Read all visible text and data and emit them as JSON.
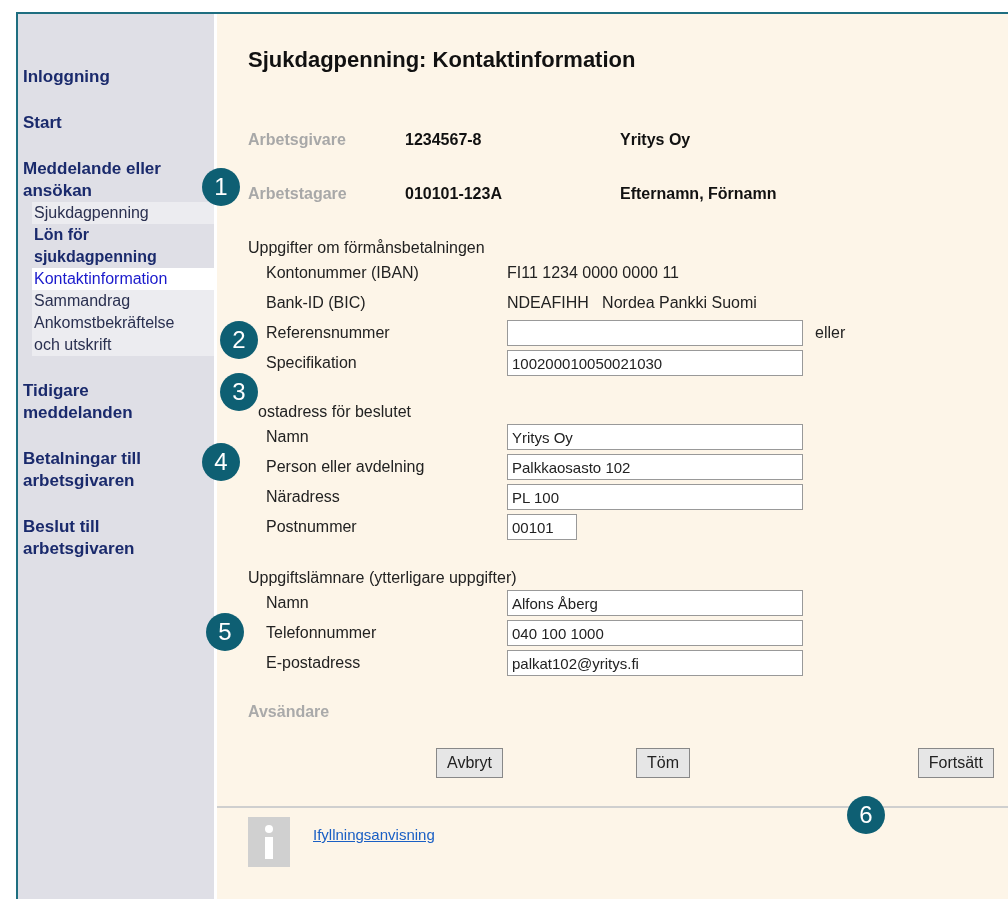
{
  "sidebar": {
    "groups": [
      {
        "label": "Inloggning"
      },
      {
        "label": "Start"
      },
      {
        "label": "Meddelande eller ansökan",
        "items": [
          {
            "label": "Sjukdagpenning",
            "kind": "link",
            "selected": false
          },
          {
            "label": "Lön för sjukdagpenning",
            "kind": "heading",
            "selected": false
          },
          {
            "label": "Kontaktinformation",
            "kind": "link",
            "selected": true
          },
          {
            "label": "Sammandrag",
            "kind": "link",
            "selected": false
          },
          {
            "label": "Ankomstbekräftelse och utskrift",
            "kind": "link",
            "selected": false
          }
        ]
      },
      {
        "label": "Tidigare meddelanden"
      },
      {
        "label": "Betalningar till arbetsgivaren"
      },
      {
        "label": "Beslut till arbetsgivaren"
      }
    ]
  },
  "page": {
    "title": "Sjukdagpenning: Kontaktinformation"
  },
  "parties": [
    {
      "label": "Arbetsgivare",
      "id": "1234567-8",
      "name": "Yritys Oy"
    },
    {
      "label": "Arbetstagare",
      "id": "010101-123A",
      "name": "Efternamn, Förnamn"
    }
  ],
  "payment": {
    "heading": "Uppgifter om förmånsbetalningen",
    "rows": [
      {
        "kind": "text",
        "label": "Kontonummer (IBAN)",
        "value": "FI11 1234 0000 0000 11"
      },
      {
        "kind": "text",
        "label": "Bank-ID (BIC)",
        "value": "NDEAFIHH   Nordea Pankki Suomi"
      },
      {
        "kind": "field",
        "label": "Referensnummer",
        "value": "",
        "note": "eller"
      },
      {
        "kind": "field",
        "label": "Specifikation",
        "value": "100200010050021030"
      }
    ]
  },
  "address": {
    "heading": "ostadress för beslutet",
    "rows": [
      {
        "kind": "field",
        "label": "Namn",
        "value": "Yritys Oy"
      },
      {
        "kind": "field",
        "label": "Person eller avdelning",
        "value": "Palkkaosasto 102"
      },
      {
        "kind": "field",
        "label": "Näradress",
        "value": "PL 100"
      },
      {
        "kind": "short",
        "label": "Postnummer",
        "value": "00101"
      }
    ]
  },
  "reporter": {
    "heading": "Uppgiftslämnare (ytterligare uppgifter)",
    "rows": [
      {
        "kind": "field",
        "label": "Namn",
        "value": "Alfons Åberg"
      },
      {
        "kind": "field",
        "label": "Telefonnummer",
        "value": "040 100 1000"
      },
      {
        "kind": "field",
        "label": "E-postadress",
        "value": "palkat102@yritys.fi"
      }
    ]
  },
  "sender": {
    "heading": "Avsändare"
  },
  "buttons": [
    "Avbryt",
    "Töm",
    "Fortsätt"
  ],
  "footer": {
    "link": "Ifyllningsanvisning"
  },
  "callouts": [
    "1",
    "2",
    "3",
    "4",
    "5",
    "6"
  ]
}
